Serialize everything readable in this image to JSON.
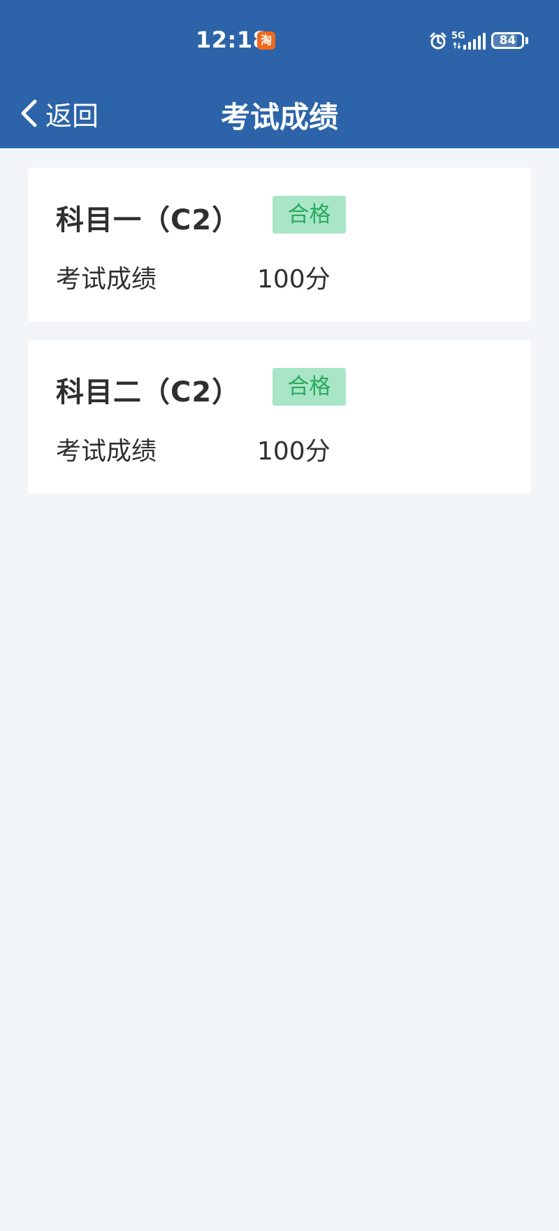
{
  "status_bar": {
    "time": "12:18",
    "notification_icon": "taobao-icon",
    "notification_text": "淘",
    "network": "5G",
    "battery": "84",
    "battery_level": 0.84
  },
  "nav": {
    "back_label": "返回",
    "title": "考试成绩"
  },
  "results": [
    {
      "subject": "科目一（C2）",
      "status": "合格",
      "score_label": "考试成绩",
      "score": "100分"
    },
    {
      "subject": "科目二（C2）",
      "status": "合格",
      "score_label": "考试成绩",
      "score": "100分"
    }
  ],
  "colors": {
    "header_blue": "#2d64a9",
    "page_background": "#f3f6f8",
    "pass_badge_background": "#a9e6c7",
    "pass_badge_text": "#2aaa5e",
    "battery_tip": "#ffffff"
  }
}
